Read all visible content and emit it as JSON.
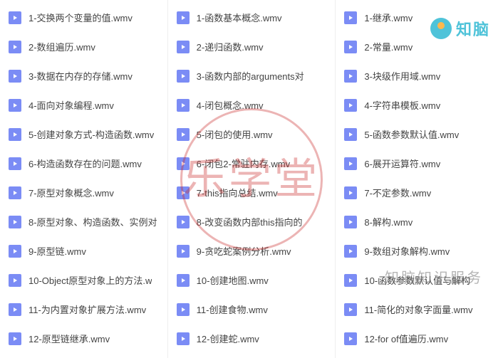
{
  "logo_text": "知脑",
  "watermark_seal": "乐学堂",
  "watermark_text": "知脑知识服务",
  "columns": [
    {
      "files": [
        {
          "name": "1-交换两个变量的值.wmv"
        },
        {
          "name": "2-数组遍历.wmv"
        },
        {
          "name": "3-数据在内存的存储.wmv"
        },
        {
          "name": "4-面向对象编程.wmv"
        },
        {
          "name": "5-创建对象方式-构造函数.wmv"
        },
        {
          "name": "6-构造函数存在的问题.wmv"
        },
        {
          "name": "7-原型对象概念.wmv"
        },
        {
          "name": "8-原型对象、构造函数、实例对"
        },
        {
          "name": "9-原型链.wmv"
        },
        {
          "name": "10-Object原型对象上的方法.w"
        },
        {
          "name": "11-为内置对象扩展方法.wmv"
        },
        {
          "name": "12-原型链继承.wmv"
        }
      ]
    },
    {
      "files": [
        {
          "name": "1-函数基本概念.wmv"
        },
        {
          "name": "2-递归函数.wmv"
        },
        {
          "name": "3-函数内部的arguments对"
        },
        {
          "name": "4-闭包概念.wmv"
        },
        {
          "name": "5-闭包的使用.wmv"
        },
        {
          "name": "6-闭包2-常驻内存.wmv"
        },
        {
          "name": "7-this指向总结.wmv"
        },
        {
          "name": "8-改变函数内部this指向的"
        },
        {
          "name": "9-贪吃蛇案例分析.wmv"
        },
        {
          "name": "10-创建地图.wmv"
        },
        {
          "name": "11-创建食物.wmv"
        },
        {
          "name": "12-创建蛇.wmv"
        }
      ]
    },
    {
      "files": [
        {
          "name": "1-继承.wmv"
        },
        {
          "name": "2-常量.wmv"
        },
        {
          "name": "3-块级作用域.wmv"
        },
        {
          "name": "4-字符串模板.wmv"
        },
        {
          "name": "5-函数参数默认值.wmv"
        },
        {
          "name": "6-展开运算符.wmv"
        },
        {
          "name": "7-不定参数.wmv"
        },
        {
          "name": "8-解构.wmv"
        },
        {
          "name": "9-数组对象解构.wmv"
        },
        {
          "name": "10-函数参数默认值与解构"
        },
        {
          "name": "11-简化的对象字面量.wmv"
        },
        {
          "name": "12-for of值遍历.wmv"
        }
      ]
    }
  ]
}
